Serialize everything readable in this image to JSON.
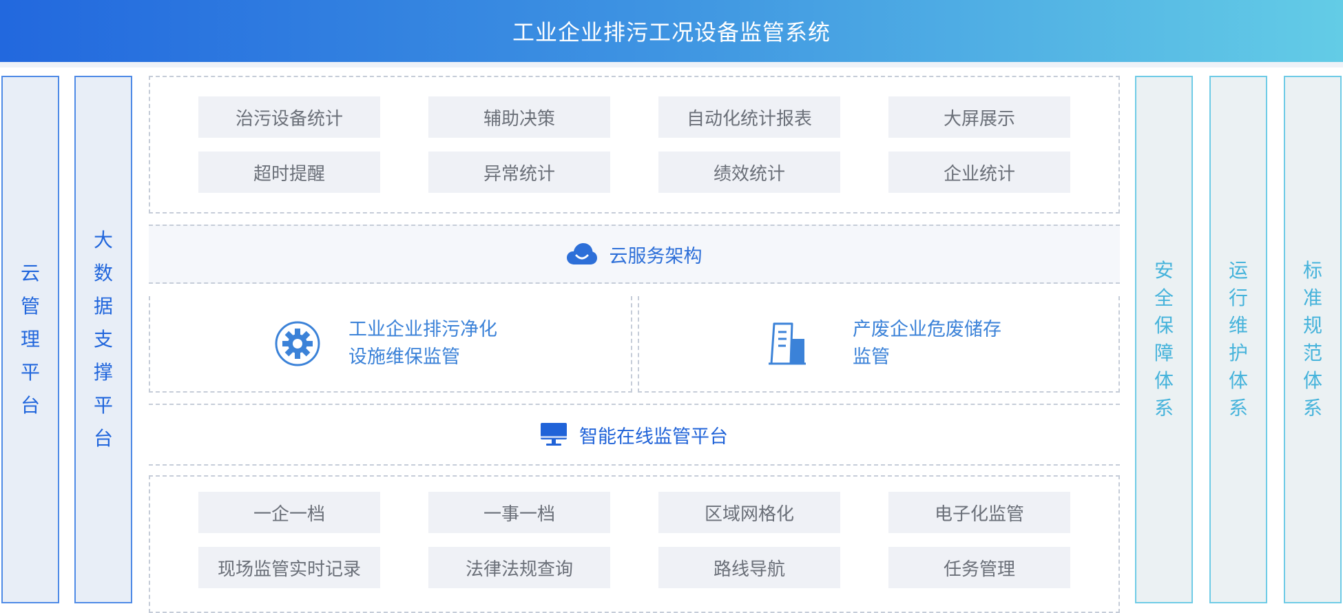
{
  "header": {
    "title": "工业企业排污工况设备监管系统"
  },
  "left_columns": [
    {
      "chars": [
        "云",
        "管",
        "理",
        "平",
        "台"
      ]
    },
    {
      "chars": [
        "大",
        "数",
        "据",
        "支",
        "撑",
        "平",
        "台"
      ]
    }
  ],
  "right_columns": [
    {
      "chars": [
        "安",
        "全",
        "保",
        "障",
        "体",
        "系"
      ]
    },
    {
      "chars": [
        "运",
        "行",
        "维",
        "护",
        "体",
        "系"
      ]
    },
    {
      "chars": [
        "标",
        "准",
        "规",
        "范",
        "体",
        "系"
      ]
    }
  ],
  "top_group": {
    "row1": [
      "治污设备统计",
      "辅助决策",
      "自动化统计报表",
      "大屏展示"
    ],
    "row2": [
      "超时提醒",
      "异常统计",
      "绩效统计",
      "企业统计"
    ]
  },
  "cloud_band": {
    "label": "云服务架构",
    "icon": "cloud-icon"
  },
  "subsystems": [
    {
      "line1": "工业企业排污净化",
      "line2": "设施维保监管",
      "icon": "gear-icon"
    },
    {
      "line1": "产废企业危废储存",
      "line2": "监管",
      "icon": "building-icon"
    }
  ],
  "monitor_band": {
    "label": "智能在线监管平台",
    "icon": "monitor-icon"
  },
  "bottom_group": {
    "row1": [
      "一企一档",
      "一事一档",
      "区域网格化",
      "电子化监管"
    ],
    "row2": [
      "现场监管实时记录",
      "法律法规查询",
      "路线导航",
      "任务管理"
    ]
  },
  "colors": {
    "banner_start": "#2268de",
    "banner_end": "#63cce6",
    "left_accent": "#2166dc",
    "right_accent": "#45b3db",
    "tile_bg": "#eff1f6",
    "tile_text": "#6a6f78"
  }
}
